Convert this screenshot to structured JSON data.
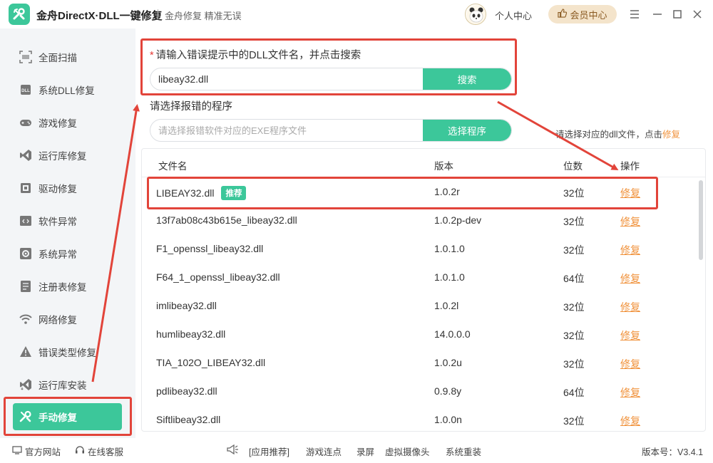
{
  "app": {
    "title": "金舟DirectX·DLL一键修复",
    "slogan": "金舟修复 精准无误",
    "user_center": "个人中心",
    "vip_center": "会员中心"
  },
  "sidebar": {
    "items": [
      {
        "label": "全面扫描",
        "icon": "scan-icon"
      },
      {
        "label": "系统DLL修复",
        "icon": "dll-icon"
      },
      {
        "label": "游戏修复",
        "icon": "gamepad-icon"
      },
      {
        "label": "运行库修复",
        "icon": "runtime-icon"
      },
      {
        "label": "驱动修复",
        "icon": "driver-icon"
      },
      {
        "label": "软件异常",
        "icon": "code-icon"
      },
      {
        "label": "系统异常",
        "icon": "gear-icon"
      },
      {
        "label": "注册表修复",
        "icon": "registry-icon"
      },
      {
        "label": "网络修复",
        "icon": "wifi-icon"
      },
      {
        "label": "错误类型修复",
        "icon": "warning-icon"
      },
      {
        "label": "运行库安装",
        "icon": "install-icon"
      },
      {
        "label": "手动修复",
        "icon": "wrench-icon",
        "active": true
      }
    ]
  },
  "search": {
    "required_mark": "*",
    "label": "请输入错误提示中的DLL文件名，并点击搜索",
    "value": "libeay32.dll",
    "button": "搜索"
  },
  "program": {
    "label": "请选择报错的程序",
    "placeholder": "请选择报错软件对应的EXE程序文件",
    "button": "选择程序"
  },
  "hint": {
    "prefix": "请选择对应的dll文件，点击",
    "highlight": "修复"
  },
  "table": {
    "columns": [
      "文件名",
      "版本",
      "位数",
      "操作"
    ],
    "rows": [
      {
        "name": "LIBEAY32.dll",
        "badge": "推荐",
        "version": "1.0.2r",
        "bits": "32位",
        "action": "修复"
      },
      {
        "name": "13f7ab08c43b615e_libeay32.dll",
        "version": "1.0.2p-dev",
        "bits": "32位",
        "action": "修复"
      },
      {
        "name": "F1_openssl_libeay32.dll",
        "version": "1.0.1.0",
        "bits": "32位",
        "action": "修复"
      },
      {
        "name": "F64_1_openssl_libeay32.dll",
        "version": "1.0.1.0",
        "bits": "64位",
        "action": "修复"
      },
      {
        "name": "imlibeay32.dll",
        "version": "1.0.2l",
        "bits": "32位",
        "action": "修复"
      },
      {
        "name": "humlibeay32.dll",
        "version": "14.0.0.0",
        "bits": "32位",
        "action": "修复"
      },
      {
        "name": "TIA_102O_LIBEAY32.dll",
        "version": "1.0.2u",
        "bits": "32位",
        "action": "修复"
      },
      {
        "name": "pdlibeay32.dll",
        "version": "0.9.8y",
        "bits": "64位",
        "action": "修复"
      },
      {
        "name": "Siftlibeay32.dll",
        "version": "1.0.0n",
        "bits": "32位",
        "action": "修复"
      }
    ]
  },
  "footer": {
    "website": "官方网站",
    "support": "在线客服",
    "recommend": "[应用推荐]",
    "links": [
      "游戏连点",
      "录屏",
      "虚拟摄像头",
      "系统重装"
    ],
    "version": "版本号：V3.4.1"
  },
  "colors": {
    "accent": "#3cc79a",
    "link": "#f0913a",
    "annotation": "#e2443a"
  }
}
